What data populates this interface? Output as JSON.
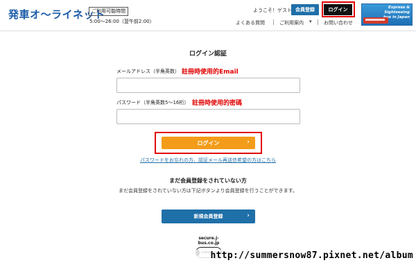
{
  "header": {
    "logo": "発車オ〜ライネット",
    "hours_badge": "ご利用可能時間",
    "hours": "5:00〜26:00（翌午前2:00）",
    "welcome": "ようこそ！ゲスト様",
    "register_button": "会員登録",
    "login_button": "ログイン",
    "banner_line1": "Express & Sightseeing",
    "banner_line2": "bus in Japan",
    "subnav": {
      "faq": "よくある質問",
      "guide": "ご利用案内",
      "guide_arrow": "▾",
      "contact": "お問い合わせ"
    }
  },
  "main": {
    "title": "ログイン認証",
    "email_label": "メールアドレス（半角英数）",
    "email_annotation": "註冊時使用的Email",
    "email_value": "",
    "password_label": "パスワード（半角英数5〜16桁）",
    "password_annotation": "註冊時使用的密碼",
    "password_value": "",
    "login_button": "ログイン",
    "login_chevron": "›",
    "forgot_link": "パスワードをお忘れの方、認証メール再送信希望の方はこちら",
    "not_registered_heading": "まだ会員登録をされていない方",
    "register_note": "まだ会員登録をされていない方は下記ボタンより会員登録を行うことができます。",
    "new_register_button": "新規会員登録",
    "new_register_chevron": "›"
  },
  "footer": {
    "seal_domain": "secure.j-bus.co.jp",
    "seal_word": "cybertrust"
  },
  "watermark": {
    "text": "http://summersnow87.pixnet.net/album"
  },
  "colors": {
    "brand_blue": "#1f6fa8",
    "login_orange": "#f39c1a",
    "annotation_red": "#e10000"
  }
}
